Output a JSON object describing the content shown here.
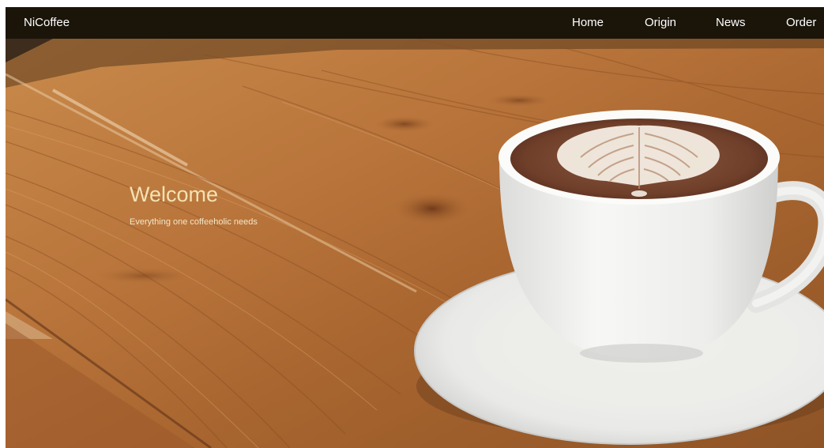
{
  "nav": {
    "brand": "NiCoffee",
    "items": [
      {
        "label": "Home"
      },
      {
        "label": "Origin"
      },
      {
        "label": "News"
      },
      {
        "label": "Order"
      }
    ]
  },
  "hero": {
    "title": "Welcome",
    "subtitle": "Everything one coffeeholic needs",
    "background": "wooden-table-with-latte-cup-photo"
  },
  "colors": {
    "navbar_background": "#1b1509",
    "nav_text": "#ffffff",
    "hero_title": "#f4e2b4",
    "wood_light": "#c8894a",
    "wood_dark": "#7a4522",
    "coffee": "#7b4a35",
    "cup": "#f2f2f0"
  }
}
